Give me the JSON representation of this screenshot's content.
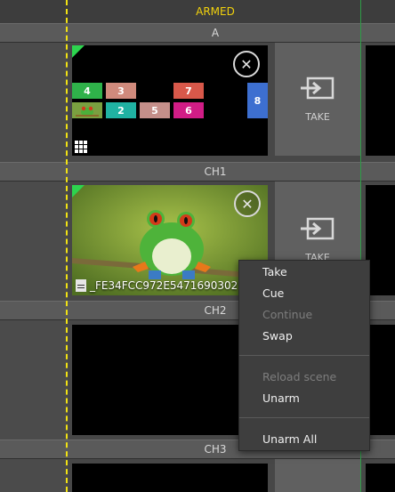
{
  "header": {
    "armed_label": "ARMED"
  },
  "channels": [
    {
      "title": "A"
    },
    {
      "title": "CH1"
    },
    {
      "title": "CH2"
    },
    {
      "title": "CH3"
    }
  ],
  "scene_tiles": [
    {
      "label": "4",
      "color": "#2fb24a"
    },
    {
      "label": "3",
      "color": "#d08a7c"
    },
    {
      "label": "7",
      "color": "#d8584a"
    },
    {
      "label": "8",
      "color": "#3d6fd0"
    },
    {
      "label": "2",
      "color": "#20b2a2"
    },
    {
      "label": "5",
      "color": "#c58f8a"
    },
    {
      "label": "6",
      "color": "#d11d86"
    }
  ],
  "take": {
    "label": "TAKE"
  },
  "media_file": {
    "name": "_FE34FCC972E5471690302"
  },
  "context_menu": {
    "items": [
      {
        "label": "Take",
        "enabled": true
      },
      {
        "label": "Cue",
        "enabled": true
      },
      {
        "label": "Continue",
        "enabled": false
      },
      {
        "label": "Swap",
        "enabled": true
      },
      {
        "label": "Reload scene",
        "enabled": false
      },
      {
        "label": "Unarm",
        "enabled": true
      },
      {
        "label": "Unarm All",
        "enabled": true
      }
    ]
  },
  "colors": {
    "armed": "#f2d20c",
    "cue_line": "#f2e313",
    "program_line": "#2e9b46",
    "active_corner": "#2dd44e"
  }
}
